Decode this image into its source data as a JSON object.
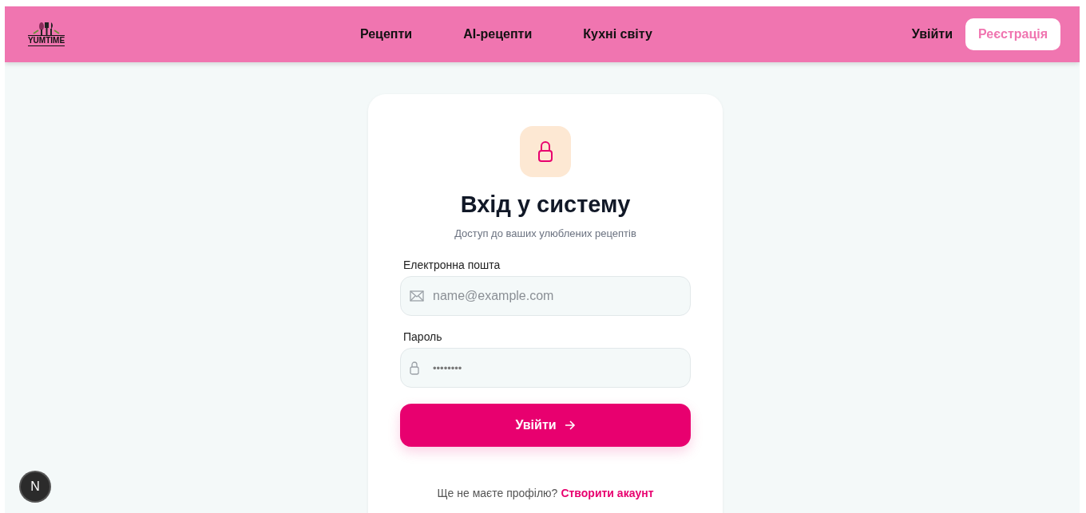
{
  "header": {
    "logo": "YUMTIME",
    "nav": [
      {
        "label": "Рецепти"
      },
      {
        "label": "AI-рецепти"
      },
      {
        "label": "Кухні світу"
      }
    ],
    "login": "Увійти",
    "register": "Реєстрація"
  },
  "card": {
    "title": "Вхід у систему",
    "subtitle": "Доступ до ваших улюблених рецептів",
    "fields": [
      {
        "kind": "email",
        "label": "Електронна пошта",
        "placeholder": "name@example.com"
      },
      {
        "kind": "password",
        "label": "Пароль",
        "value": "••••••••"
      }
    ],
    "submit": "Увійти",
    "footer_text": "Ще не маєте профілю?",
    "footer_link": "Створити акаунт"
  },
  "dev_badge": "N"
}
